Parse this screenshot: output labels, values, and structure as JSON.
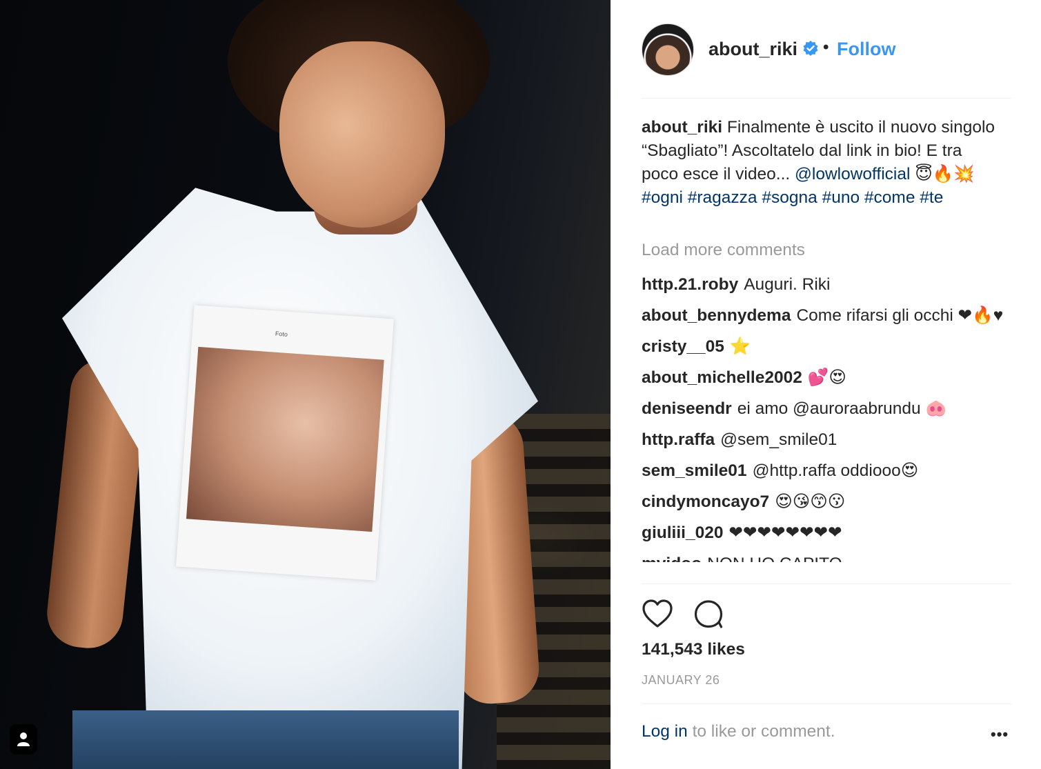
{
  "photo": {
    "print_title": "Foto"
  },
  "header": {
    "username": "about_riki",
    "separator": "•",
    "follow_label": "Follow"
  },
  "caption": {
    "username": "about_riki",
    "text": "Finalmente è uscito il nuovo singolo “Sbagliato”! Ascoltatelo dal link in bio! E tra poco esce il video...",
    "mention": "@lowlowofficial",
    "emojis": "😇🔥💥",
    "hashtags": [
      "#ogni",
      "#ragazza",
      "#sogna",
      "#uno",
      "#come",
      "#te"
    ]
  },
  "load_more": "Load more comments",
  "comments": [
    {
      "user": "http.21.roby",
      "text": "Auguri. Riki"
    },
    {
      "user": "about_bennydema",
      "text": "Come rifarsi gli occhi ❤🔥♥"
    },
    {
      "user": "cristy__05",
      "text": "⭐"
    },
    {
      "user": "about_michelle2002",
      "text": "💕😍"
    },
    {
      "user": "deniseendr",
      "text": "ei amo @auroraabrundu 🐽"
    },
    {
      "user": "http.raffa",
      "text": "@sem_smile01"
    },
    {
      "user": "sem_smile01",
      "text": "@http.raffa oddiooo😍"
    },
    {
      "user": "cindymoncayo7",
      "text": "😍😘😙😗"
    },
    {
      "user": "giuliii_020",
      "text": "❤❤❤❤❤❤❤❤"
    },
    {
      "user": "mvidoo",
      "text": "NON HO CAPITO"
    }
  ],
  "likes": "141,543 likes",
  "date": "JANUARY 26",
  "login": {
    "link": "Log in",
    "rest": " to like or comment."
  },
  "more": "•••",
  "colors": {
    "link_blue": "#3897f0",
    "text": "#262626",
    "muted": "#999999",
    "divider": "#efefef"
  }
}
